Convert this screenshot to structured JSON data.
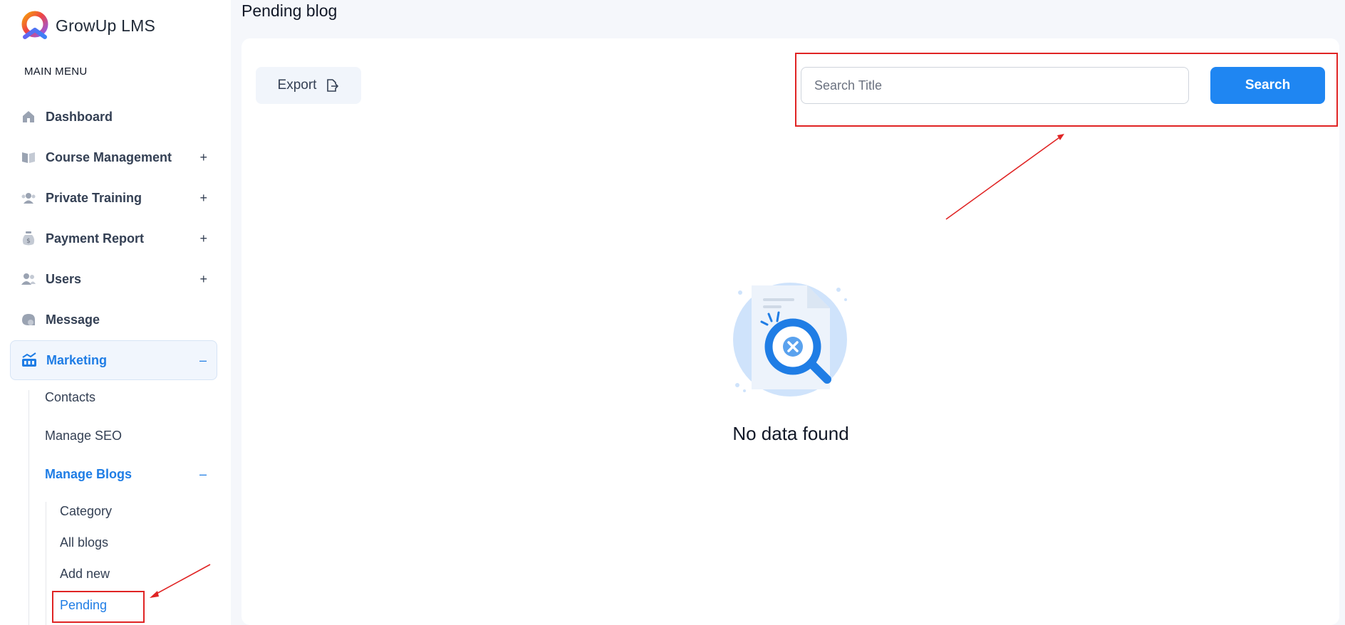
{
  "app": {
    "name": "GrowUp LMS",
    "menu_heading": "MAIN MENU"
  },
  "sidebar": {
    "items": [
      {
        "label": "Dashboard",
        "icon": "home-icon",
        "toggle": ""
      },
      {
        "label": "Course Management",
        "icon": "book-icon",
        "toggle": "+"
      },
      {
        "label": "Private Training",
        "icon": "group-icon",
        "toggle": "+"
      },
      {
        "label": "Payment Report",
        "icon": "money-bag-icon",
        "toggle": "+"
      },
      {
        "label": "Users",
        "icon": "users-icon",
        "toggle": "+"
      },
      {
        "label": "Message",
        "icon": "chat-icon",
        "toggle": ""
      },
      {
        "label": "Marketing",
        "icon": "marketing-icon",
        "toggle": "–",
        "active": true
      }
    ],
    "marketing_submenu": [
      {
        "label": "Contacts"
      },
      {
        "label": "Manage SEO"
      },
      {
        "label": "Manage Blogs",
        "toggle": "–",
        "expanded": true
      }
    ],
    "blogs_submenu": [
      {
        "label": "Category"
      },
      {
        "label": "All blogs"
      },
      {
        "label": "Add new"
      },
      {
        "label": "Pending",
        "active": true
      }
    ]
  },
  "main": {
    "title": "Pending blog",
    "export_label": "Export",
    "search_placeholder": "Search Title",
    "search_value": "",
    "search_button": "Search",
    "empty_message": "No data found"
  },
  "colors": {
    "accent": "#1f86f2",
    "active_text": "#1f7de5",
    "annotation": "#e02424"
  }
}
